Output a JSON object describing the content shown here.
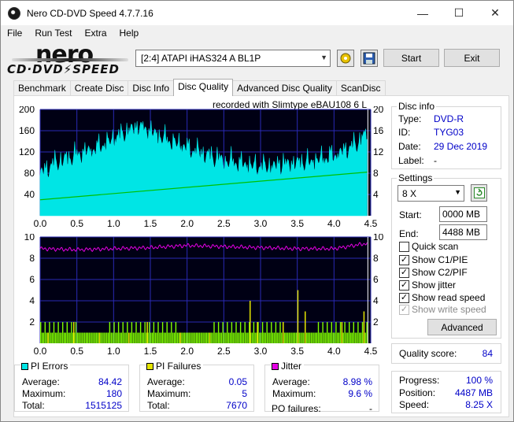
{
  "window": {
    "title": "Nero CD-DVD Speed 4.7.7.16"
  },
  "menu": {
    "items": [
      "File",
      "Run Test",
      "Extra",
      "Help"
    ]
  },
  "logo": {
    "top": "nero",
    "bottom": "CD·DVD⚡SPEED"
  },
  "toolbar": {
    "drive": "[2:4]   ATAPI iHAS324   A BL1P",
    "start_label": "Start",
    "exit_label": "Exit"
  },
  "tabs": [
    "Benchmark",
    "Create Disc",
    "Disc Info",
    "Disc Quality",
    "Advanced Disc Quality",
    "ScanDisc"
  ],
  "active_tab": "Disc Quality",
  "recorded_with": "recorded with Slimtype eBAU108  6 L",
  "disc_info": {
    "title": "Disc info",
    "type_label": "Type:",
    "type": "DVD-R",
    "id_label": "ID:",
    "id": "TYG03",
    "date_label": "Date:",
    "date": "29 Dec 2019",
    "label_label": "Label:",
    "label": "-"
  },
  "settings": {
    "title": "Settings",
    "speed": "8 X",
    "start_label": "Start:",
    "start": "0000 MB",
    "end_label": "End:",
    "end": "4488 MB",
    "checks": [
      {
        "label": "Quick scan",
        "checked": false,
        "enabled": true
      },
      {
        "label": "Show C1/PIE",
        "checked": true,
        "enabled": true
      },
      {
        "label": "Show C2/PIF",
        "checked": true,
        "enabled": true
      },
      {
        "label": "Show jitter",
        "checked": true,
        "enabled": true
      },
      {
        "label": "Show read speed",
        "checked": true,
        "enabled": true
      },
      {
        "label": "Show write speed",
        "checked": true,
        "enabled": false
      }
    ],
    "advanced_label": "Advanced"
  },
  "quality": {
    "label": "Quality score:",
    "score": "84"
  },
  "progress": {
    "progress_label": "Progress:",
    "progress": "100 %",
    "position_label": "Position:",
    "position": "4487 MB",
    "speed_label": "Speed:",
    "speed": "8.25 X"
  },
  "pi_errors": {
    "title": "PI Errors",
    "color": "#00e5e5",
    "avg_label": "Average:",
    "avg": "84.42",
    "max_label": "Maximum:",
    "max": "180",
    "total_label": "Total:",
    "total": "1515125"
  },
  "pi_failures": {
    "title": "PI Failures",
    "color": "#e5e500",
    "avg_label": "Average:",
    "avg": "0.05",
    "max_label": "Maximum:",
    "max": "5",
    "total_label": "Total:",
    "total": "7670"
  },
  "jitter": {
    "title": "Jitter",
    "color": "#e500e5",
    "avg_label": "Average:",
    "avg": "8.98 %",
    "max_label": "Maximum:",
    "max": "9.6 %",
    "po_label": "PO failures:",
    "po": "-"
  },
  "chart_data": [
    {
      "type": "area",
      "name": "PI Errors / read speed",
      "x_ticks": [
        "0.0",
        "0.5",
        "1.0",
        "1.5",
        "2.0",
        "2.5",
        "3.0",
        "3.5",
        "4.0",
        "4.5"
      ],
      "y_ticks_left": [
        "200",
        "160",
        "120",
        "80",
        "40"
      ],
      "y_ticks_right": [
        "20",
        "16",
        "12",
        "8",
        "4"
      ],
      "xlim": [
        0,
        4.5
      ],
      "ylim": [
        0,
        200
      ],
      "y2lim": [
        0,
        20
      ],
      "pi_errors": {
        "x": [
          0.0,
          0.2,
          0.4,
          0.6,
          0.8,
          1.0,
          1.2,
          1.35,
          1.5,
          1.7,
          1.9,
          2.1,
          2.3,
          2.5,
          2.7,
          2.9,
          3.1,
          3.3,
          3.5,
          3.7,
          3.9,
          4.1,
          4.3,
          4.45
        ],
        "y": [
          75,
          95,
          105,
          115,
          125,
          140,
          155,
          165,
          155,
          140,
          130,
          118,
          108,
          100,
          95,
          90,
          88,
          92,
          95,
          98,
          105,
          115,
          130,
          150
        ],
        "color": "#00e5e5"
      },
      "read_speed": {
        "x": [
          0.0,
          4.45
        ],
        "y": [
          3.0,
          8.2
        ],
        "color": "#00c000"
      }
    },
    {
      "type": "bar",
      "name": "PI Failures / jitter",
      "x_ticks": [
        "0.0",
        "0.5",
        "1.0",
        "1.5",
        "2.0",
        "2.5",
        "3.0",
        "3.5",
        "4.0",
        "4.5"
      ],
      "y_ticks_left": [
        "10",
        "8",
        "6",
        "4",
        "2"
      ],
      "y_ticks_right": [
        "10",
        "8",
        "6",
        "4",
        "2"
      ],
      "xlim": [
        0,
        4.5
      ],
      "ylim": [
        0,
        10
      ],
      "pi_failures": {
        "x": [
          0.1,
          0.45,
          0.8,
          1.2,
          1.45,
          1.9,
          2.3,
          2.85,
          2.95,
          3.3,
          3.5,
          3.6,
          4.1,
          4.4
        ],
        "y": [
          1,
          2,
          1,
          1,
          2,
          1,
          1,
          4,
          2,
          2,
          5,
          3,
          2,
          3
        ],
        "color": "#e5e500"
      },
      "jitter": {
        "x": [
          0.0,
          0.5,
          1.0,
          1.5,
          2.0,
          2.5,
          3.0,
          3.5,
          4.0,
          4.45
        ],
        "y": [
          8.9,
          8.8,
          8.9,
          9.0,
          9.2,
          9.1,
          9.0,
          8.9,
          8.9,
          9.4
        ],
        "color": "#e500e5"
      }
    }
  ]
}
